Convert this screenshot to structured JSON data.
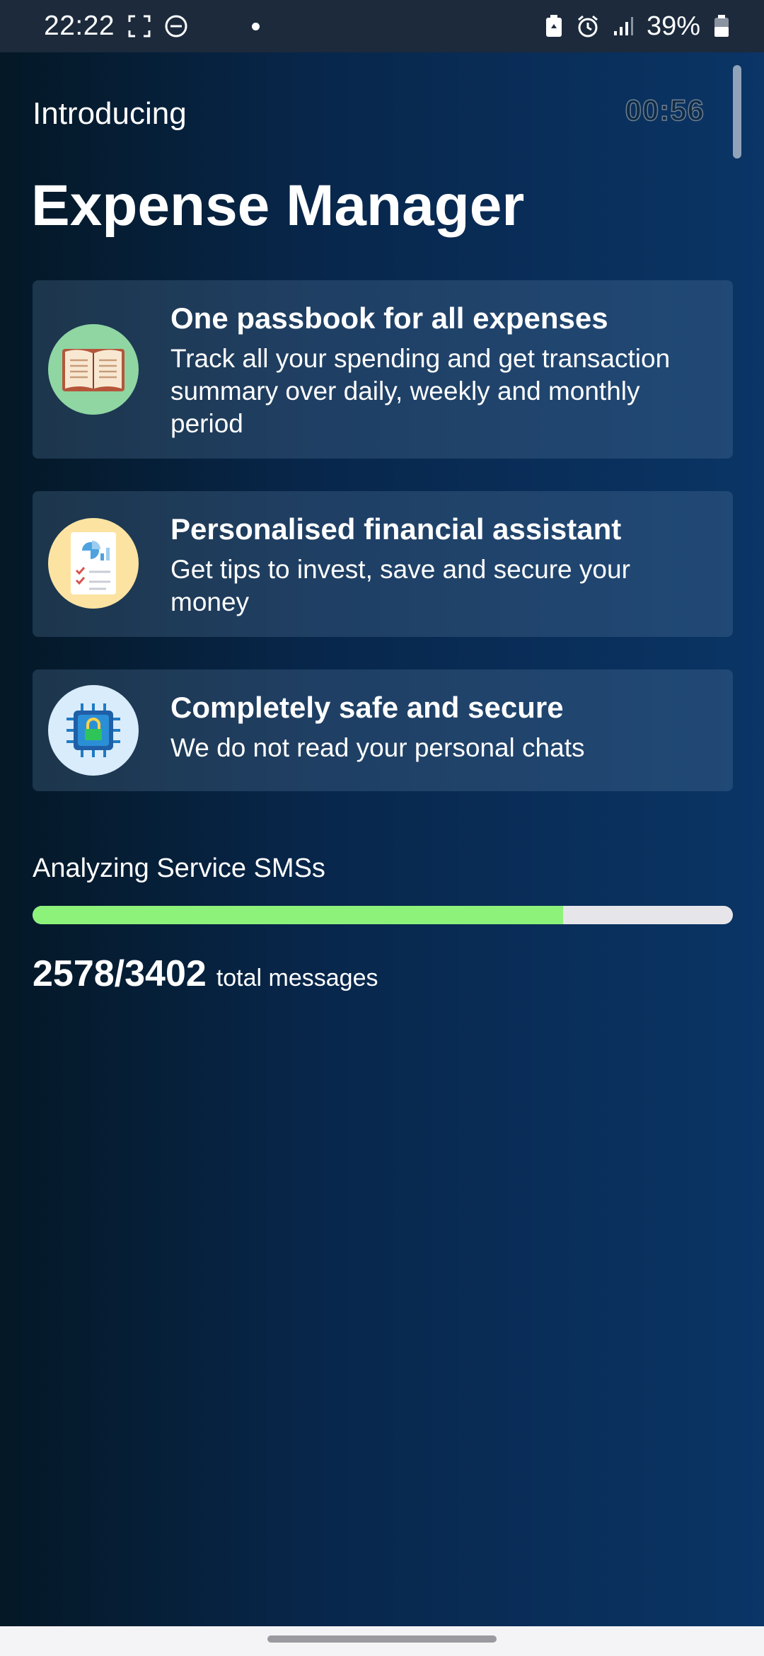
{
  "status_bar": {
    "time": "22:22",
    "battery": "39%",
    "icons": [
      "screenshot-frame-icon",
      "do-not-disturb-icon",
      "notification-dot-icon",
      "battery-saver-icon",
      "alarm-icon",
      "signal-icon",
      "battery-icon"
    ]
  },
  "header": {
    "intro": "Introducing",
    "timer": "00:56",
    "title": "Expense Manager"
  },
  "features": [
    {
      "icon": "book-icon",
      "title": "One passbook for all expenses",
      "description": "Track all your spending and get transaction summary over daily, weekly and monthly period"
    },
    {
      "icon": "report-icon",
      "title": "Personalised financial assistant",
      "description": "Get tips to invest, save and secure your money"
    },
    {
      "icon": "chip-lock-icon",
      "title": "Completely safe and secure",
      "description": "We do not read your personal chats"
    }
  ],
  "progress": {
    "label": "Analyzing Service SMSs",
    "current": 2578,
    "total": 3402,
    "count_text": "2578/3402",
    "suffix": "total messages",
    "fill_color": "#8df27a",
    "track_color": "#e6e6ea"
  },
  "colors": {
    "accent_green": "#8df27a",
    "background_dark": "#041826",
    "background_light": "#0a3566"
  }
}
